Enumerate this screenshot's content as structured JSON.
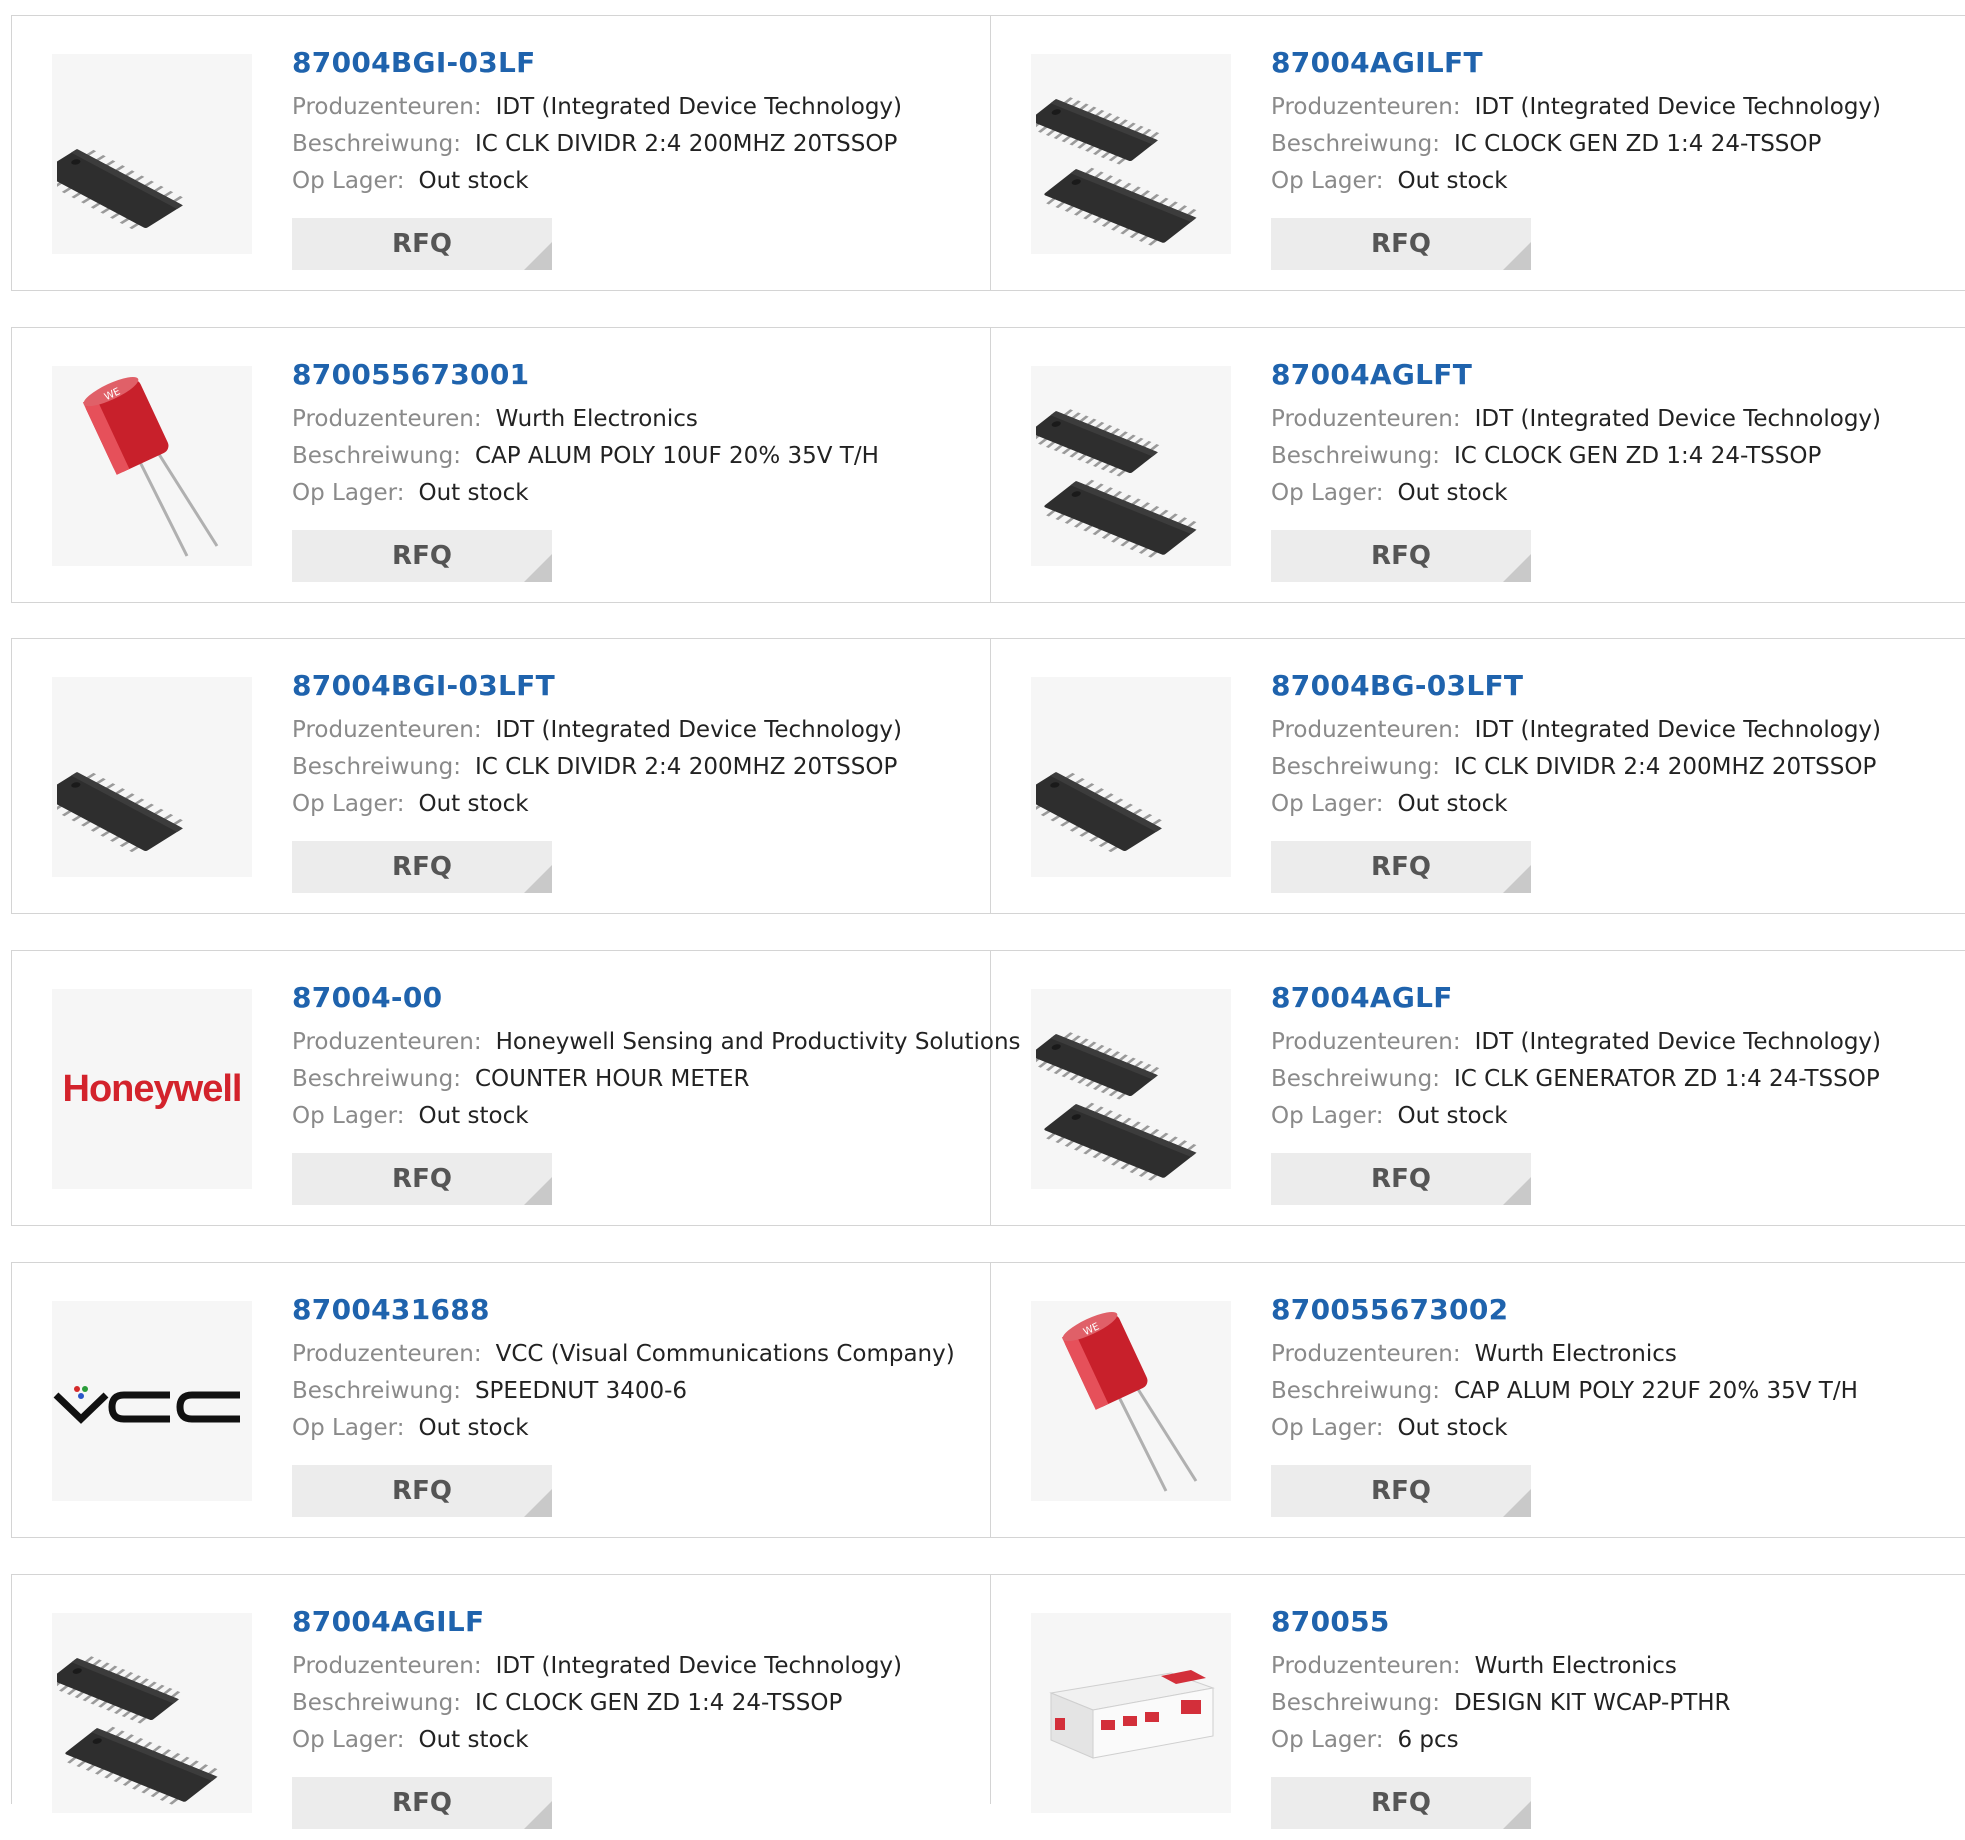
{
  "labels": {
    "manufacturer": "Produzenteuren:",
    "description": "Beschreiwung:",
    "stock": "Op Lager:",
    "rfq": "RFQ"
  },
  "rows": [
    [
      {
        "part": "87004BGI-03LF",
        "manufacturer": "IDT (Integrated Device Technology)",
        "description": "IC CLK DIVIDR 2:4 200MHZ 20TSSOP",
        "stock": "Out stock",
        "image": "chip-20tssop"
      },
      {
        "part": "87004AGILFT",
        "manufacturer": "IDT (Integrated Device Technology)",
        "description": "IC CLOCK GEN ZD 1:4 24-TSSOP",
        "stock": "Out stock",
        "image": "chip-pair-24tssop"
      }
    ],
    [
      {
        "part": "870055673001",
        "manufacturer": "Wurth Electronics",
        "description": "CAP ALUM POLY 10UF 20% 35V T/H",
        "stock": "Out stock",
        "image": "capacitor"
      },
      {
        "part": "87004AGLFT",
        "manufacturer": "IDT (Integrated Device Technology)",
        "description": "IC CLOCK GEN ZD 1:4 24-TSSOP",
        "stock": "Out stock",
        "image": "chip-pair-24tssop"
      }
    ],
    [
      {
        "part": "87004BGI-03LFT",
        "manufacturer": "IDT (Integrated Device Technology)",
        "description": "IC CLK DIVIDR 2:4 200MHZ 20TSSOP",
        "stock": "Out stock",
        "image": "chip-20tssop"
      },
      {
        "part": "87004BG-03LFT",
        "manufacturer": "IDT (Integrated Device Technology)",
        "description": "IC CLK DIVIDR 2:4 200MHZ 20TSSOP",
        "stock": "Out stock",
        "image": "chip-20tssop"
      }
    ],
    [
      {
        "part": "87004-00",
        "manufacturer": "Honeywell Sensing and Productivity Solutions",
        "description": "COUNTER HOUR METER",
        "stock": "Out stock",
        "image": "honeywell-logo",
        "logo_text": "Honeywell"
      },
      {
        "part": "87004AGLF",
        "manufacturer": "IDT (Integrated Device Technology)",
        "description": "IC CLK GENERATOR ZD 1:4 24-TSSOP",
        "stock": "Out stock",
        "image": "chip-pair-24tssop"
      }
    ],
    [
      {
        "part": "8700431688",
        "manufacturer": "VCC (Visual Communications Company)",
        "description": "SPEEDNUT 3400-6",
        "stock": "Out stock",
        "image": "vcc-logo",
        "logo_text": "VCC"
      },
      {
        "part": "870055673002",
        "manufacturer": "Wurth Electronics",
        "description": "CAP ALUM POLY 22UF 20% 35V T/H",
        "stock": "Out stock",
        "image": "capacitor"
      }
    ],
    [
      {
        "part": "87004AGILF",
        "manufacturer": "IDT (Integrated Device Technology)",
        "description": "IC CLOCK GEN ZD 1:4 24-TSSOP",
        "stock": "Out stock",
        "image": "chip-pair-24tssop"
      },
      {
        "part": "870055",
        "manufacturer": "Wurth Electronics",
        "description": "DESIGN KIT WCAP-PTHR",
        "stock": "6 pcs",
        "image": "design-kit-box"
      }
    ]
  ]
}
